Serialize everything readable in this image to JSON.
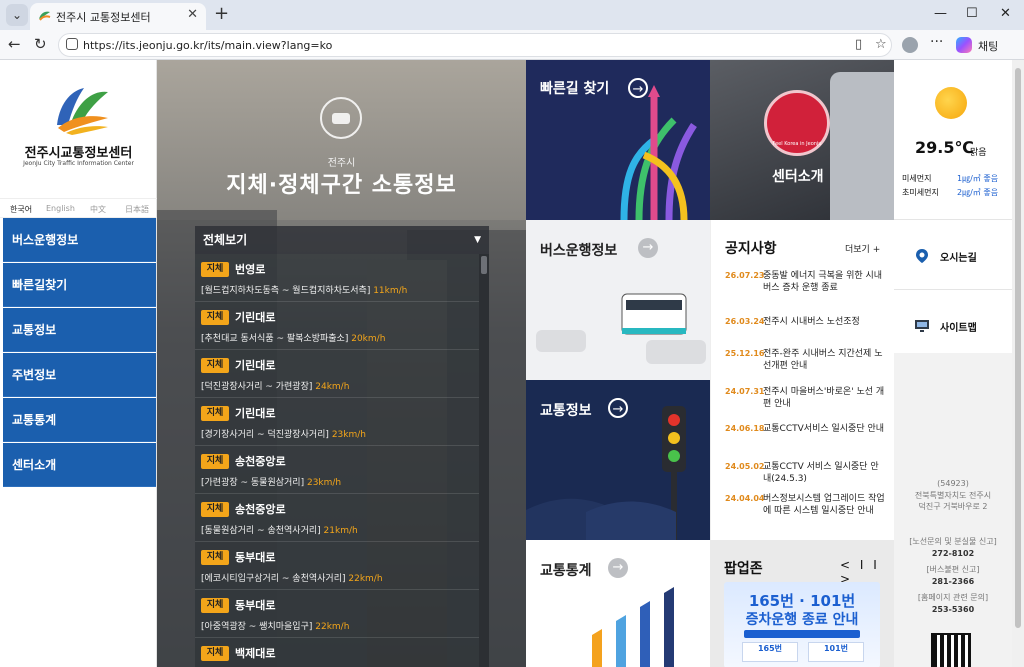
{
  "browser": {
    "tab_title": "전주시 교통정보센터",
    "url": "https://its.jeonju.go.kr/its/main.view?lang=ko",
    "chat_label": "채팅"
  },
  "brand": {
    "title": "전주시교통정보센터",
    "subtitle": "JeonJu City Traffic Information Center"
  },
  "languages": [
    "한국어",
    "English",
    "中文",
    "日本語"
  ],
  "nav": [
    "버스운행정보",
    "빠른길찾기",
    "교통정보",
    "주변정보",
    "교통통계",
    "센터소개"
  ],
  "hero": {
    "city": "전주시",
    "title": "지체·정체구간 소통정보",
    "filter": "전체보기"
  },
  "traffic": [
    {
      "badge": "지체",
      "road": "번영로",
      "section": "[월드컵지하차도동측 ~ 월드컵지하차도서측]",
      "speed": "11km/h"
    },
    {
      "badge": "지체",
      "road": "기린대로",
      "section": "[추천대교 동서식품 ~ 팔복소방파출소]",
      "speed": "20km/h"
    },
    {
      "badge": "지체",
      "road": "기린대로",
      "section": "[덕진광장사거리 ~ 가련광장]",
      "speed": "24km/h"
    },
    {
      "badge": "지체",
      "road": "기린대로",
      "section": "[경기장사거리 ~ 덕진광장사거리]",
      "speed": "23km/h"
    },
    {
      "badge": "지체",
      "road": "송천중앙로",
      "section": "[가련광장 ~ 동물원삼거리]",
      "speed": "23km/h"
    },
    {
      "badge": "지체",
      "road": "송천중앙로",
      "section": "[동물원삼거리 ~ 송천역사거리]",
      "speed": "21km/h"
    },
    {
      "badge": "지체",
      "road": "동부대로",
      "section": "[에코시티입구삼거리 ~ 송천역사거리]",
      "speed": "22km/h"
    },
    {
      "badge": "지체",
      "road": "동부대로",
      "section": "[아중역광장 ~ 쌩치마을입구]",
      "speed": "22km/h"
    },
    {
      "badge": "지체",
      "road": "백제대로",
      "section": "",
      "speed": ""
    }
  ],
  "tiles": {
    "route": "빠른길 찾기",
    "center": "센터소개",
    "center_badge": "Feel Korea in Jeonju",
    "bus": "버스운행정보",
    "traffic": "교통정보",
    "stats": "교통통계",
    "popup": "팝업존"
  },
  "notices": {
    "title": "공지사항",
    "more": "더보기 +",
    "items": [
      {
        "date": "26.07.23",
        "text": "중동발 에너지 극복을 위한 시내버스 증차 운행 종료"
      },
      {
        "date": "26.03.24",
        "text": "전주시 시내버스 노선조정"
      },
      {
        "date": "25.12.16",
        "text": "전주-완주 시내버스 지간선제 노선개편 안내"
      },
      {
        "date": "24.07.31",
        "text": "전주시 마을버스'바로온' 노선 개편 안내"
      },
      {
        "date": "24.06.18",
        "text": "교통CCTV서비스 일시중단 안내"
      },
      {
        "date": "24.05.02",
        "text": "교통CCTV 서비스 일시중단 안내(24.5.3)"
      },
      {
        "date": "24.04.04",
        "text": "버스정보시스템 업그레이드 작업에 따른 시스템 일시중단 안내"
      }
    ]
  },
  "popup": {
    "nav": "< I I >",
    "line1": "165번 · 101번",
    "line2": "증차운행 종료 안내",
    "t1": "165번",
    "t2": "101번"
  },
  "weather": {
    "temp": "29.5℃",
    "cond": "맑음",
    "fine_label": "미세먼지",
    "fine_value": "1㎍/㎥",
    "fine_grade": "좋음",
    "ultra_label": "초미세먼지",
    "ultra_value": "2㎍/㎥",
    "ultra_grade": "좋음"
  },
  "links": [
    "오시는길",
    "사이트맵"
  ],
  "contact": {
    "postcode": "(54923)",
    "addr1": "전북특별자치도 전주시",
    "addr2": "덕진구 거북바우로 2",
    "c1": "[노선문의 및 분실물 신고]",
    "p1": "272-8102",
    "c2": "[버스불편 신고]",
    "p2": "281-2366",
    "c3": "[홈페이지 관련 문의]",
    "p3": "253-5360"
  },
  "colors": {
    "nav_blue": "#1b5fae",
    "badge": "#f3a51a",
    "tile_navy": "#1f2a5c",
    "tile_dark": "#1a2a52"
  }
}
